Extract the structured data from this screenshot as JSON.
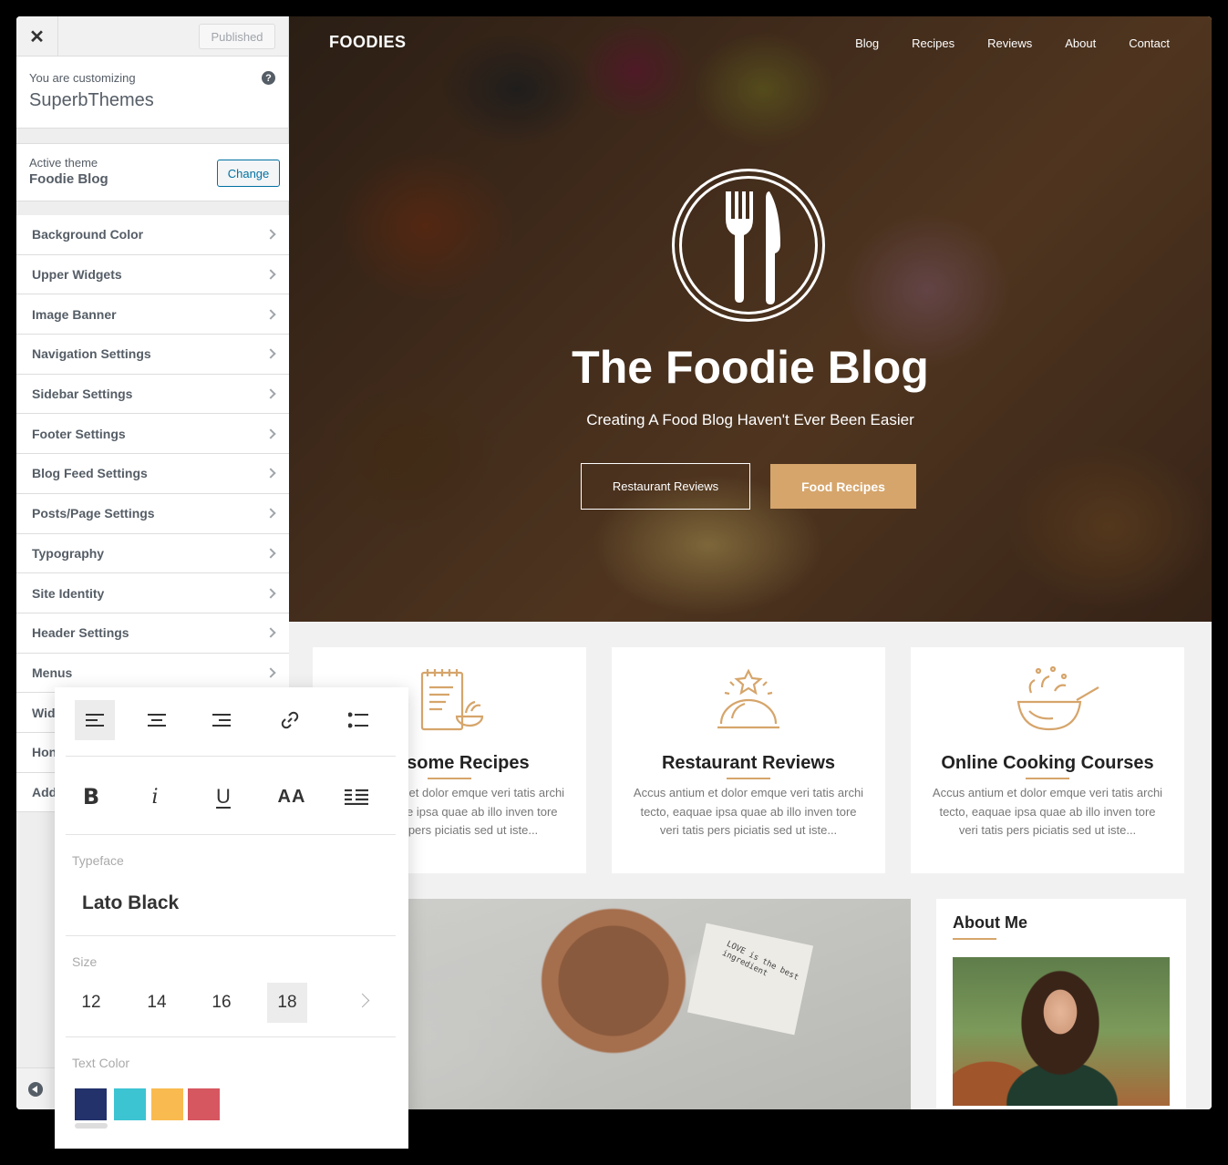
{
  "customizer": {
    "published_label": "Published",
    "customizing_label": "You are customizing",
    "site_name": "SuperbThemes",
    "active_theme_label": "Active theme",
    "theme_name": "Foodie Blog",
    "change_label": "Change",
    "items": [
      {
        "label": "Background Color"
      },
      {
        "label": "Upper Widgets"
      },
      {
        "label": "Image Banner"
      },
      {
        "label": "Navigation Settings"
      },
      {
        "label": "Sidebar Settings"
      },
      {
        "label": "Footer Settings"
      },
      {
        "label": "Blog Feed Settings"
      },
      {
        "label": "Posts/Page Settings"
      },
      {
        "label": "Typography"
      },
      {
        "label": "Site Identity"
      },
      {
        "label": "Header Settings"
      },
      {
        "label": "Menus"
      },
      {
        "label": "Wid"
      },
      {
        "label": "Hon"
      },
      {
        "label": "Add"
      }
    ]
  },
  "site": {
    "logo": "FOODIES",
    "nav": [
      "Blog",
      "Recipes",
      "Reviews",
      "About",
      "Contact"
    ],
    "hero_title": "The Foodie Blog",
    "hero_subtitle": "Creating A Food Blog Haven't Ever Been Easier",
    "btn_reviews": "Restaurant Reviews",
    "btn_recipes": "Food Recipes",
    "cards": [
      {
        "title": "Awesome Recipes",
        "text": "Accus antium et dolor emque veri tatis archi tecto, eaquae ipsa quae ab illo inven tore veri tatis pers piciatis sed ut iste...",
        "icon": "recipe-clipboard-icon"
      },
      {
        "title": "Restaurant Reviews",
        "text": "Accus antium et dolor emque veri tatis archi tecto, eaquae ipsa quae ab illo inven tore veri tatis pers piciatis sed ut iste...",
        "icon": "cloche-star-icon"
      },
      {
        "title": "Online Cooking Courses",
        "text": "Accus antium et dolor emque veri tatis archi tecto, eaquae ipsa quae ab illo inven tore veri tatis pers piciatis sed ut iste...",
        "icon": "wok-pan-icon"
      }
    ],
    "napkin_text": "LOVE is the best ingredient",
    "about_title": "About Me"
  },
  "popover": {
    "typeface_label": "Typeface",
    "typeface_value": "Lato Black",
    "size_label": "Size",
    "sizes": [
      "12",
      "14",
      "16",
      "18"
    ],
    "selected_size": "18",
    "text_color_label": "Text Color",
    "colors": [
      "#23326b",
      "#3cc4d2",
      "#f9bb4f",
      "#d65760"
    ],
    "italic_glyph": "i",
    "caps_glyph": "AA"
  },
  "accent_color": "#d6a56b"
}
